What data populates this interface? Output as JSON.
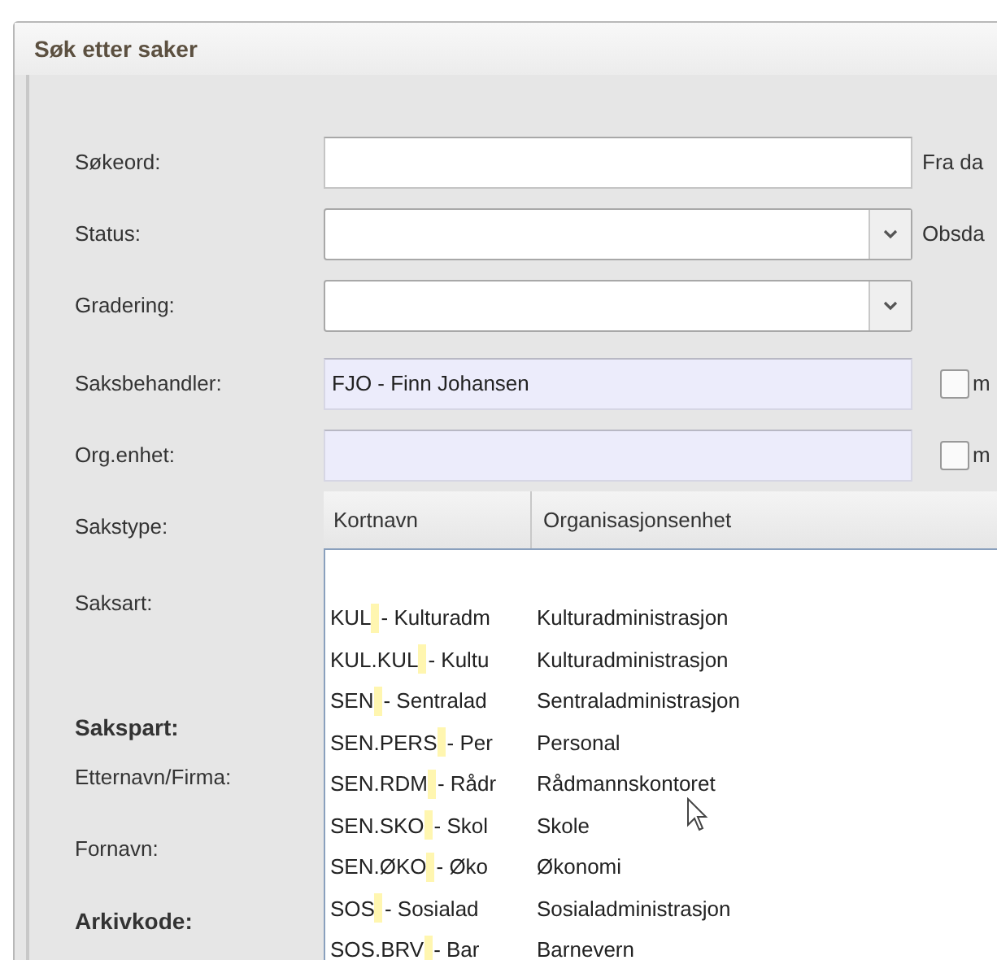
{
  "dialog": {
    "title": "Søk etter saker"
  },
  "fields": [
    {
      "kind": "text",
      "label": "Søkeord:",
      "side_label": "Fra da"
    },
    {
      "kind": "select",
      "label": "Status:",
      "side_label": "Obsda"
    },
    {
      "kind": "select",
      "label": "Gradering:"
    },
    {
      "kind": "lookup",
      "label": "Saksbehandler:",
      "value": "FJO - Finn Johansen",
      "checkbox": {
        "label": "m",
        "checked": false
      }
    },
    {
      "kind": "lookup",
      "label": "Org.enhet:",
      "checkbox": {
        "label": "m",
        "checked": false
      }
    }
  ],
  "left_labels": [
    {
      "text": "Sakstype:",
      "bold": false
    },
    {
      "text": "Saksart:",
      "bold": false
    },
    {
      "text": "Sakspart:",
      "bold": true
    },
    {
      "text": "Etternavn/Firma:",
      "bold": false
    },
    {
      "text": "Fornavn:",
      "bold": false
    },
    {
      "text": "Arkivkode:",
      "bold": true
    }
  ],
  "dropdown": {
    "columns": [
      "Kortnavn",
      "Organisasjonsenhet"
    ],
    "rows": [
      {
        "code": "KUL",
        "name_short": "- Kulturadm",
        "unit": "Kulturadministrasjon"
      },
      {
        "code": "KUL.KUL",
        "name_short": "- Kultu",
        "unit": "Kulturadministrasjon"
      },
      {
        "code": "SEN",
        "name_short": "- Sentralad",
        "unit": "Sentraladministrasjon"
      },
      {
        "code": "SEN.PERS",
        "name_short": "- Per",
        "unit": "Personal"
      },
      {
        "code": "SEN.RDM",
        "name_short": "- Rådr",
        "unit": "Rådmannskontoret"
      },
      {
        "code": "SEN.SKO",
        "name_short": "- Skol",
        "unit": "Skole"
      },
      {
        "code": "SEN.ØKO",
        "name_short": "- Øko",
        "unit": "Økonomi"
      },
      {
        "code": "SOS",
        "name_short": "- Sosialad",
        "unit": "Sosialadministrasjon"
      },
      {
        "code": "SOS.BRV",
        "name_short": "- Bar",
        "unit": "Barnevern"
      }
    ]
  }
}
